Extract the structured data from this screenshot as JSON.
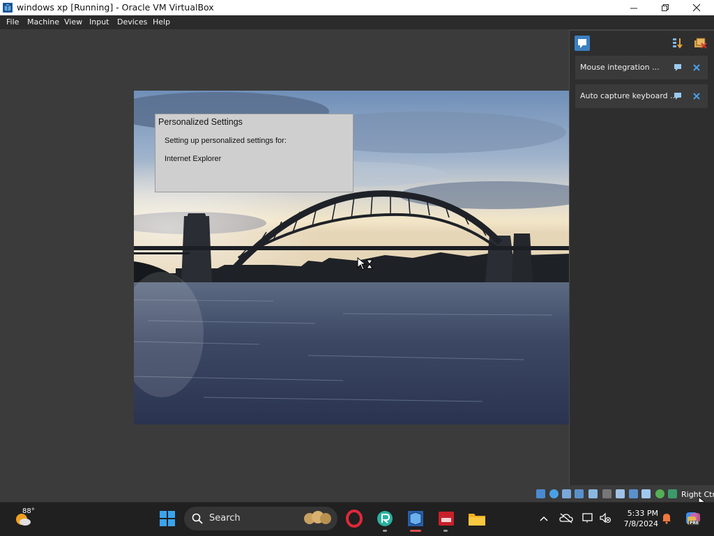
{
  "window": {
    "title": "windows xp [Running] - Oracle VM VirtualBox"
  },
  "menu": {
    "items": [
      "File",
      "Machine",
      "View",
      "Input",
      "Devices",
      "Help"
    ]
  },
  "guest": {
    "dialog": {
      "title": "Personalized Settings",
      "line1": "Setting up personalized settings for:",
      "line2": "Internet Explorer"
    }
  },
  "notifications": {
    "items": [
      {
        "text": "Mouse integration ..."
      },
      {
        "text": "Auto capture keyboard ..."
      }
    ]
  },
  "statusbar": {
    "host_key": "Right Ctrl"
  },
  "taskbar": {
    "weather_temp": "88°",
    "search_label": "Search",
    "time": "5:33 PM",
    "date": "7/8/2024",
    "copilot_badge": "PRE"
  },
  "colors": {
    "accent": "#2b9bd8",
    "vm_bg": "#3b3b3b",
    "taskbar": "#202020"
  }
}
